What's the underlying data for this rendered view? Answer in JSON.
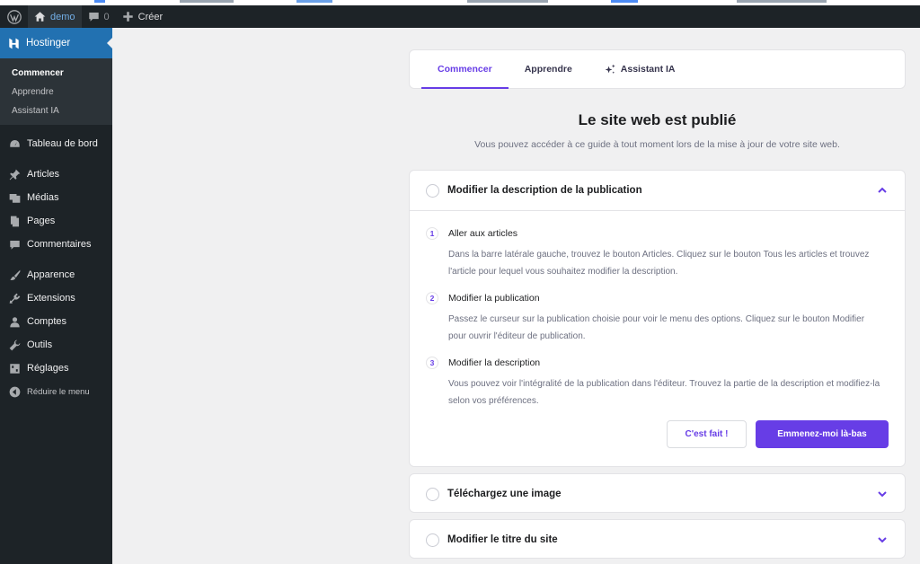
{
  "adminbar": {
    "site_name": "demo",
    "comments_count": "0",
    "new_label": "Créer"
  },
  "sidebar": {
    "header": "Hostinger",
    "submenu": [
      "Commencer",
      "Apprendre",
      "Assistant IA"
    ],
    "items": [
      "Tableau de bord",
      "Articles",
      "Médias",
      "Pages",
      "Commentaires",
      "Apparence",
      "Extensions",
      "Comptes",
      "Outils",
      "Réglages",
      "Réduire le menu"
    ]
  },
  "tabs": [
    "Commencer",
    "Apprendre",
    "Assistant IA"
  ],
  "page": {
    "title": "Le site web est publié",
    "subtitle": "Vous pouvez accéder à ce guide à tout moment lors de la mise à jour de votre site web."
  },
  "accordions": [
    {
      "title": "Modifier la description de la publication",
      "expanded": true,
      "steps": [
        {
          "num": "1",
          "title": "Aller aux articles",
          "desc": "Dans la barre latérale gauche, trouvez le bouton Articles. Cliquez sur le bouton Tous les articles et trouvez l'article pour lequel vous souhaitez modifier la description."
        },
        {
          "num": "2",
          "title": "Modifier la publication",
          "desc": "Passez le curseur sur la publication choisie pour voir le menu des options. Cliquez sur le bouton Modifier pour ouvrir l'éditeur de publication."
        },
        {
          "num": "3",
          "title": "Modifier la description",
          "desc": "Vous pouvez voir l'intégralité de la publication dans l'éditeur. Trouvez la partie de la description et modifiez-la selon vos préférences."
        }
      ],
      "done_label": "C'est fait !",
      "go_label": "Emmenez-moi là-bas"
    },
    {
      "title": "Téléchargez une image",
      "expanded": false
    },
    {
      "title": "Modifier le titre du site",
      "expanded": false
    }
  ],
  "colors": {
    "accent": "#673de6",
    "admin_bg": "#1d2327",
    "wp_blue": "#2271b1"
  }
}
